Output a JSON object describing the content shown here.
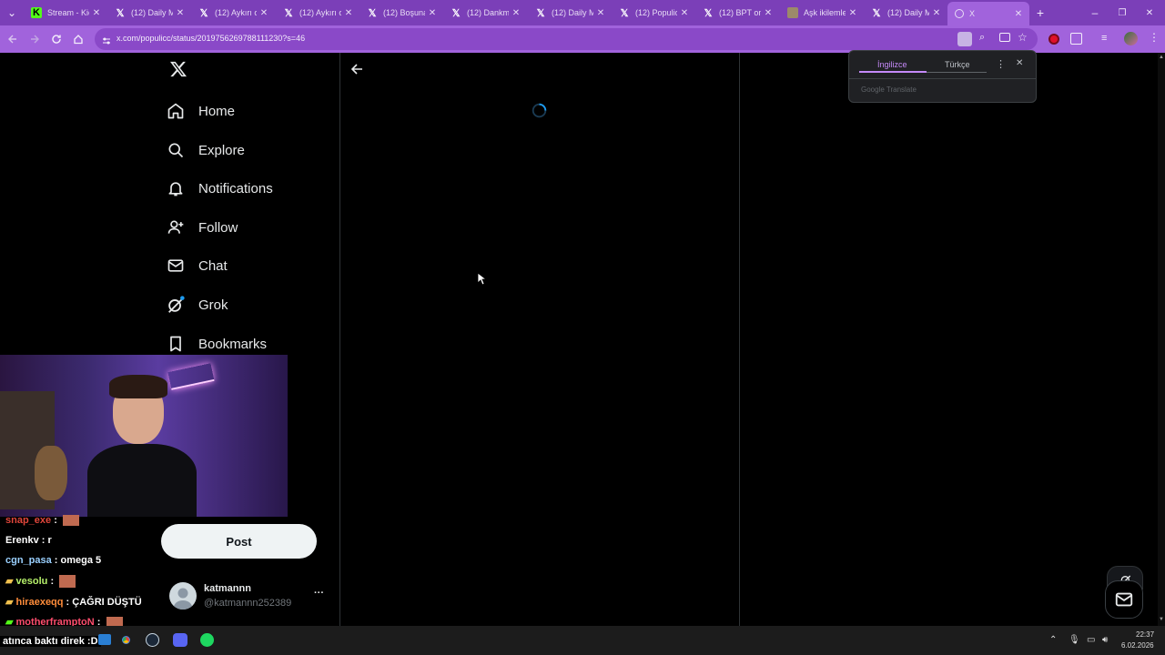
{
  "browser": {
    "tabs": [
      {
        "title": "Stream - Kick",
        "favicon": "K",
        "fav_color": "#53fc18"
      },
      {
        "title": "(12) Daily M...",
        "favicon": "X"
      },
      {
        "title": "(12) Aykırı or...",
        "favicon": "X"
      },
      {
        "title": "(12) Aykırı or...",
        "favicon": "X"
      },
      {
        "title": "(12) Boşuna...",
        "favicon": "X"
      },
      {
        "title": "(12) Dankme...",
        "favicon": "X"
      },
      {
        "title": "(12) Daily M...",
        "favicon": "X"
      },
      {
        "title": "(12) Populic...",
        "favicon": "X"
      },
      {
        "title": "(12) BPT on ...",
        "favicon": "X"
      },
      {
        "title": "Aşk ikilemle...",
        "favicon": "img"
      },
      {
        "title": "(12) Daily M...",
        "favicon": "X"
      },
      {
        "title": "X",
        "favicon": "globe",
        "active": true
      }
    ],
    "new_tab": "+",
    "url": "x.com/populicc/status/2019756269788111230?s=46",
    "window_controls": {
      "minimize": "–",
      "restore": "❐",
      "close": "✕"
    }
  },
  "translate_popup": {
    "tab_source": "İngilizce",
    "tab_target": "Türkçe",
    "footer": "Google Translate"
  },
  "x": {
    "logo": "𝕏",
    "nav": [
      {
        "label": "Home",
        "icon": "home-icon"
      },
      {
        "label": "Explore",
        "icon": "search-icon"
      },
      {
        "label": "Notifications",
        "icon": "bell-icon"
      },
      {
        "label": "Follow",
        "icon": "follow-icon"
      },
      {
        "label": "Chat",
        "icon": "mail-icon"
      },
      {
        "label": "Grok",
        "icon": "grok-icon"
      },
      {
        "label": "Bookmarks",
        "icon": "bookmark-icon"
      }
    ],
    "post_button": "Post",
    "account": {
      "name": "katmannn",
      "handle": "@katmannn252389",
      "more": "···"
    },
    "colors": {
      "accent": "#1d9bf0",
      "bg": "#000000",
      "text": "#e7e9ea"
    }
  },
  "stream_overlay": {
    "chat": [
      {
        "user": "snap_exe",
        "text": " :",
        "color": "#e0463b"
      },
      {
        "user": "Erenkv",
        "text": " : r",
        "color": "#ffffff"
      },
      {
        "user": "cgn_pasa",
        "text": " : omega 5",
        "color": "#9ad0ff"
      },
      {
        "user": "vesolu",
        "text": " :",
        "color": "#b6f06a"
      },
      {
        "user": "hiraexeqq",
        "text": " : ÇAĞRI DÜŞTÜ",
        "color": "#ff8c3a"
      },
      {
        "user": "motherframptoN",
        "text": " :",
        "color": "#ff4d6d"
      }
    ],
    "ticker": "atınca baktı direk :D"
  },
  "taskbar": {
    "time": "22:37",
    "date": "6.02.2026"
  }
}
